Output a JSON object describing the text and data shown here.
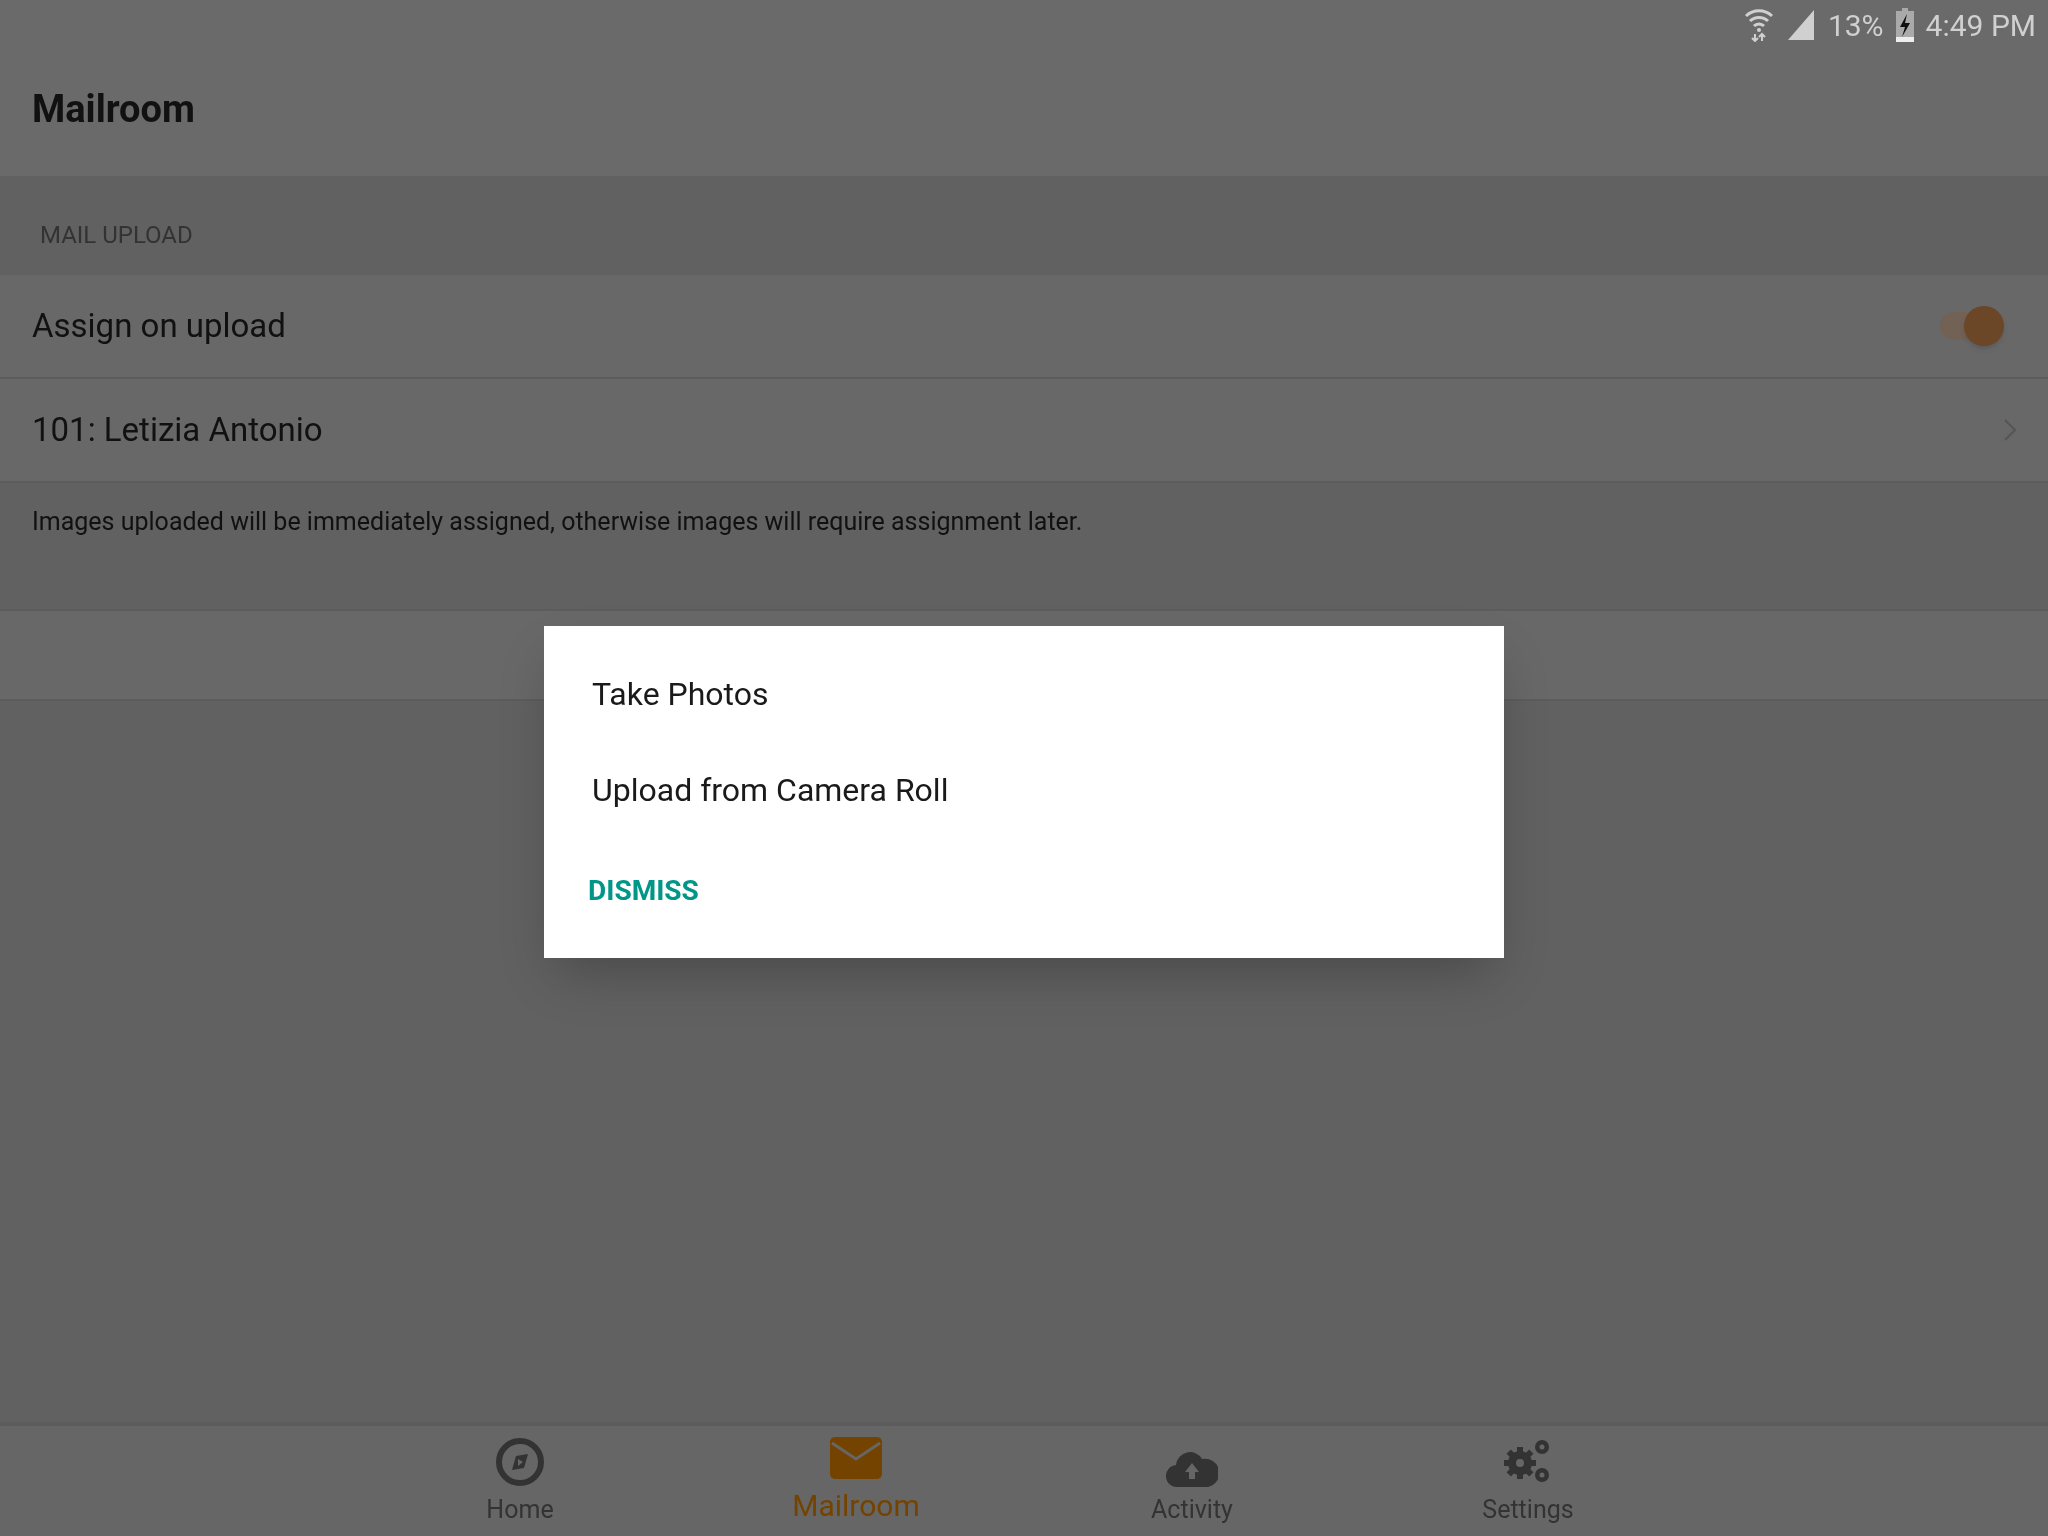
{
  "status_bar": {
    "battery": "13%",
    "time": "4:49 PM"
  },
  "app_bar": {
    "title": "Mailroom"
  },
  "section": {
    "header": "MAIL UPLOAD",
    "rows": [
      {
        "kind": "toggle",
        "label": "Assign on upload",
        "on": true
      },
      {
        "kind": "nav",
        "label": "101: Letizia Antonio"
      }
    ],
    "note": "Images uploaded will be immediately assigned, otherwise images will require assignment later."
  },
  "dialog": {
    "options": [
      "Take Photos",
      "Upload from Camera Roll"
    ],
    "dismiss": "DISMISS"
  },
  "bottom_nav": [
    {
      "kind": "home",
      "label": "Home",
      "selected": false
    },
    {
      "kind": "mail",
      "label": "Mailroom",
      "selected": true
    },
    {
      "kind": "activity",
      "label": "Activity",
      "selected": false
    },
    {
      "kind": "settings",
      "label": "Settings",
      "selected": false
    }
  ]
}
